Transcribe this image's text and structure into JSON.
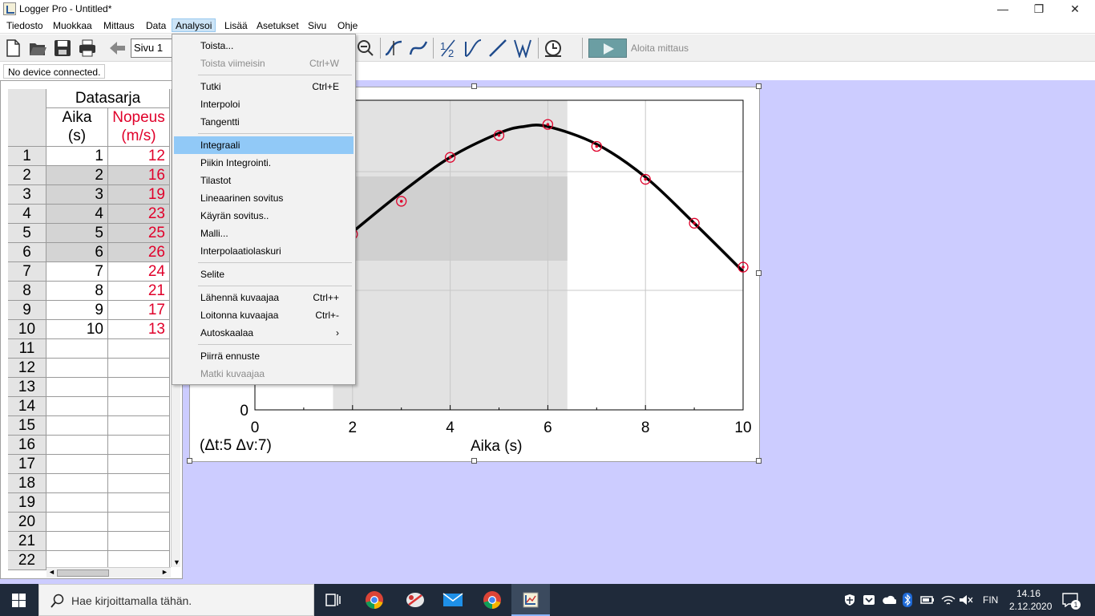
{
  "window": {
    "title": "Logger Pro - Untitled*",
    "minimize": "—",
    "restore": "❐",
    "close": "✕"
  },
  "menubar": {
    "items": [
      "Tiedosto",
      "Muokkaa",
      "Mittaus",
      "Data",
      "Analysoi",
      "Lisää",
      "Asetukset",
      "Sivu",
      "Ohje"
    ],
    "active": "Analysoi"
  },
  "toolbar": {
    "page_value": "Sivu 1",
    "start_label": "Aloita mittaus",
    "icons": [
      "new-file-icon",
      "open-folder-icon",
      "save-icon",
      "print-icon",
      "back-arrow-icon",
      "zoom-out-icon",
      "examine-icon",
      "tangent-icon",
      "integral-icon",
      "stats-icon",
      "linear-fit-icon",
      "curve-fit-icon",
      "clock-icon",
      "play-icon"
    ]
  },
  "status": {
    "device": "No device connected."
  },
  "table": {
    "title": "Datasarja",
    "col1_name": "Aika",
    "col1_unit": "(s)",
    "col2_name": "Nopeus",
    "col2_unit": "(m/s)",
    "col2_color": "#e0002a",
    "row_numbers": [
      "1",
      "2",
      "3",
      "4",
      "5",
      "6",
      "7",
      "8",
      "9",
      "10",
      "11",
      "12",
      "13",
      "14",
      "15",
      "16",
      "17",
      "18",
      "19",
      "20",
      "21",
      "22"
    ],
    "aika": [
      "1",
      "2",
      "3",
      "4",
      "5",
      "6",
      "7",
      "8",
      "9",
      "10"
    ],
    "nopeus": [
      "12",
      "16",
      "19",
      "23",
      "25",
      "26",
      "24",
      "21",
      "17",
      "13"
    ],
    "selected_rows": [
      2,
      3,
      4,
      5,
      6
    ]
  },
  "dropdown": {
    "items": [
      {
        "label": "Toista...",
        "shortcut": "",
        "disabled": false
      },
      {
        "label": "Toista viimeisin",
        "shortcut": "Ctrl+W",
        "disabled": true
      },
      {
        "label": "Tutki",
        "shortcut": "Ctrl+E",
        "disabled": false
      },
      {
        "label": "Interpoloi",
        "shortcut": "",
        "disabled": false
      },
      {
        "label": "Tangentti",
        "shortcut": "",
        "disabled": false
      },
      {
        "label": "Integraali",
        "shortcut": "",
        "disabled": false,
        "highlighted": true
      },
      {
        "label": "Piikin Integrointi.",
        "shortcut": "",
        "disabled": false
      },
      {
        "label": "Tilastot",
        "shortcut": "",
        "disabled": false
      },
      {
        "label": "Lineaarinen sovitus",
        "shortcut": "",
        "disabled": false
      },
      {
        "label": "Käyrän sovitus..",
        "shortcut": "",
        "disabled": false
      },
      {
        "label": "Malli...",
        "shortcut": "",
        "disabled": false
      },
      {
        "label": "Interpolaatiolaskuri",
        "shortcut": "",
        "disabled": false
      },
      {
        "label": "Selite",
        "shortcut": "",
        "disabled": false
      },
      {
        "label": "Lähennä kuvaajaa",
        "shortcut": "Ctrl++",
        "disabled": false
      },
      {
        "label": "Loitonna kuvaajaa",
        "shortcut": "Ctrl+-",
        "disabled": false
      },
      {
        "label": "Autoskaalaa",
        "shortcut": "›",
        "disabled": false
      },
      {
        "label": "Piirrä ennuste",
        "shortcut": "",
        "disabled": false
      },
      {
        "label": "Matki kuvaajaa",
        "shortcut": "",
        "disabled": true
      }
    ]
  },
  "chart_data": {
    "type": "scatter",
    "xlabel": "Aika (s)",
    "ylabel": "",
    "xlim": [
      0,
      10
    ],
    "xticks": [
      "0",
      "2",
      "4",
      "6",
      "8",
      "10"
    ],
    "yticks_visible": [
      "0"
    ],
    "series": [
      {
        "name": "Nopeus",
        "x": [
          1,
          2,
          3,
          4,
          5,
          6,
          7,
          8,
          9,
          10
        ],
        "y": [
          12,
          16,
          19,
          23,
          25,
          26,
          24,
          21,
          17,
          13
        ],
        "color": "#e0002a"
      }
    ],
    "fit_curve": {
      "color": "#000000",
      "x": [
        2,
        3,
        4,
        5,
        5.5,
        6,
        7,
        8,
        9,
        10
      ],
      "y": [
        16.2,
        19.8,
        23,
        25.2,
        25.8,
        25.8,
        24.2,
        21.2,
        17,
        12.6
      ]
    },
    "selected_region_x": [
      1.6,
      6.4
    ],
    "annotation": "(Δt:5 Δv:7)",
    "grid": true
  },
  "taskbar": {
    "search_placeholder": "Hae kirjoittamalla tähän.",
    "language": "FIN",
    "time": "14.16",
    "date": "2.12.2020",
    "notification_count": "1"
  }
}
